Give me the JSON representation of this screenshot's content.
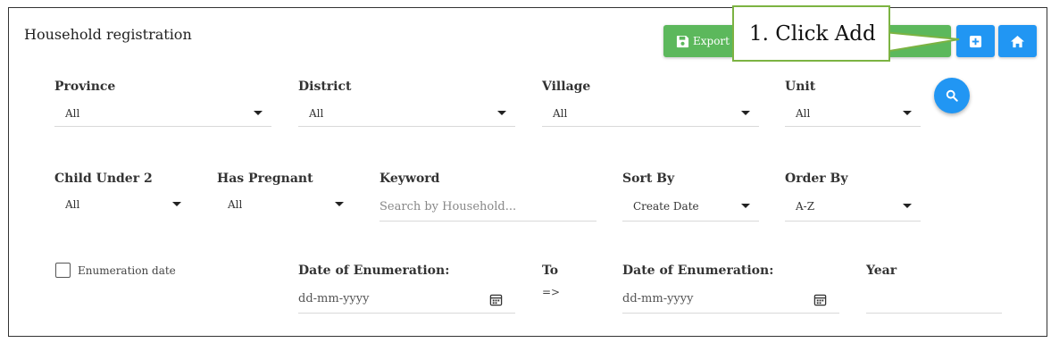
{
  "header": {
    "title": "Household registration",
    "export_label": "Export F",
    "callout_text": "1. Click Add"
  },
  "filters": {
    "province": {
      "label": "Province",
      "value": "All"
    },
    "district": {
      "label": "District",
      "value": "All"
    },
    "village": {
      "label": "Village",
      "value": "All"
    },
    "unit": {
      "label": "Unit",
      "value": "All"
    },
    "child_under_2": {
      "label": "Child Under 2",
      "value": "All"
    },
    "has_pregnant": {
      "label": "Has Pregnant",
      "value": "All"
    },
    "keyword": {
      "label": "Keyword",
      "placeholder": "Search by Household..."
    },
    "sort_by": {
      "label": "Sort By",
      "value": "Create Date"
    },
    "order_by": {
      "label": "Order By",
      "value": "A-Z"
    },
    "enumeration_checkbox_label": "Enumeration date",
    "date_from": {
      "label": "Date of Enumeration:",
      "placeholder": "dd-mm-yyyy"
    },
    "to_label": "To",
    "to_arrow": "=>",
    "date_to": {
      "label": "Date of Enumeration:",
      "placeholder": "dd-mm-yyyy"
    },
    "year": {
      "label": "Year",
      "value": ""
    }
  },
  "icons": {
    "export": "floppy-disk-icon",
    "add": "plus-square-icon",
    "home": "home-icon",
    "search": "search-icon",
    "calendar": "calendar-icon"
  },
  "colors": {
    "primary": "#2196f3",
    "success": "#5cb85c",
    "callout_border": "#7cb342"
  }
}
